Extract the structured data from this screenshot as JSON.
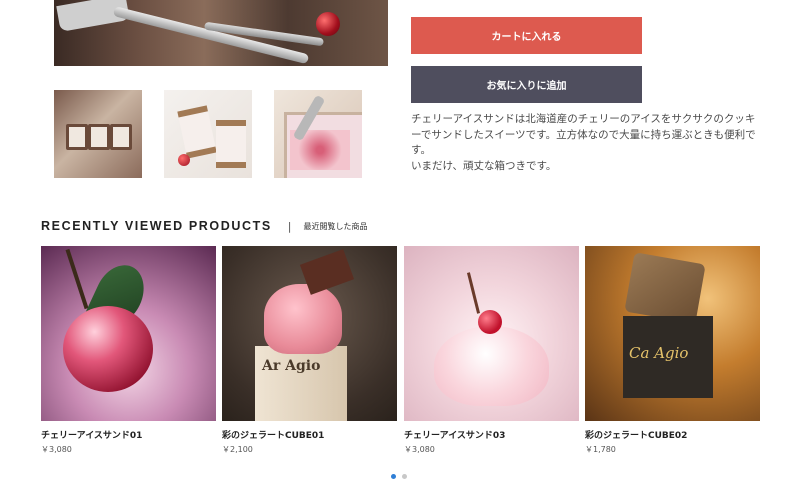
{
  "product": {
    "cart_button": "カートに入れる",
    "favorite_button": "お気に入りに追加",
    "description": [
      "チェリーアイスサンドは北海道産のチェリーのアイスをサクサクのクッキーでサンドしたスイーツです。立方体なので大量に持ち運ぶときも便利です。",
      "いまだけ、頑丈な箱つきです。"
    ]
  },
  "recently_viewed": {
    "title": "RECENTLY VIEWED PRODUCTS",
    "separator": "|",
    "subtitle": "最近閲覧した商品",
    "items": [
      {
        "name": "チェリーアイスサンド01",
        "price": "￥3,080"
      },
      {
        "name": "彩のジェラートCUBE01",
        "price": "￥2,100"
      },
      {
        "name": "チェリーアイスサンド03",
        "price": "￥3,080"
      },
      {
        "name": "彩のジェラートCUBE02",
        "price": "￥1,780"
      }
    ],
    "image_texts": [
      "Ar Agio",
      "Ca Agio"
    ],
    "carousel": {
      "pages": 2,
      "active": 1
    }
  },
  "colors": {
    "cart_button": "#dd5a4f",
    "favorite_button": "#4f4e5e",
    "carousel_active": "#2f7fd6"
  },
  "icons": [
    "cherry-photo",
    "ice-cream-scoop-photo"
  ]
}
